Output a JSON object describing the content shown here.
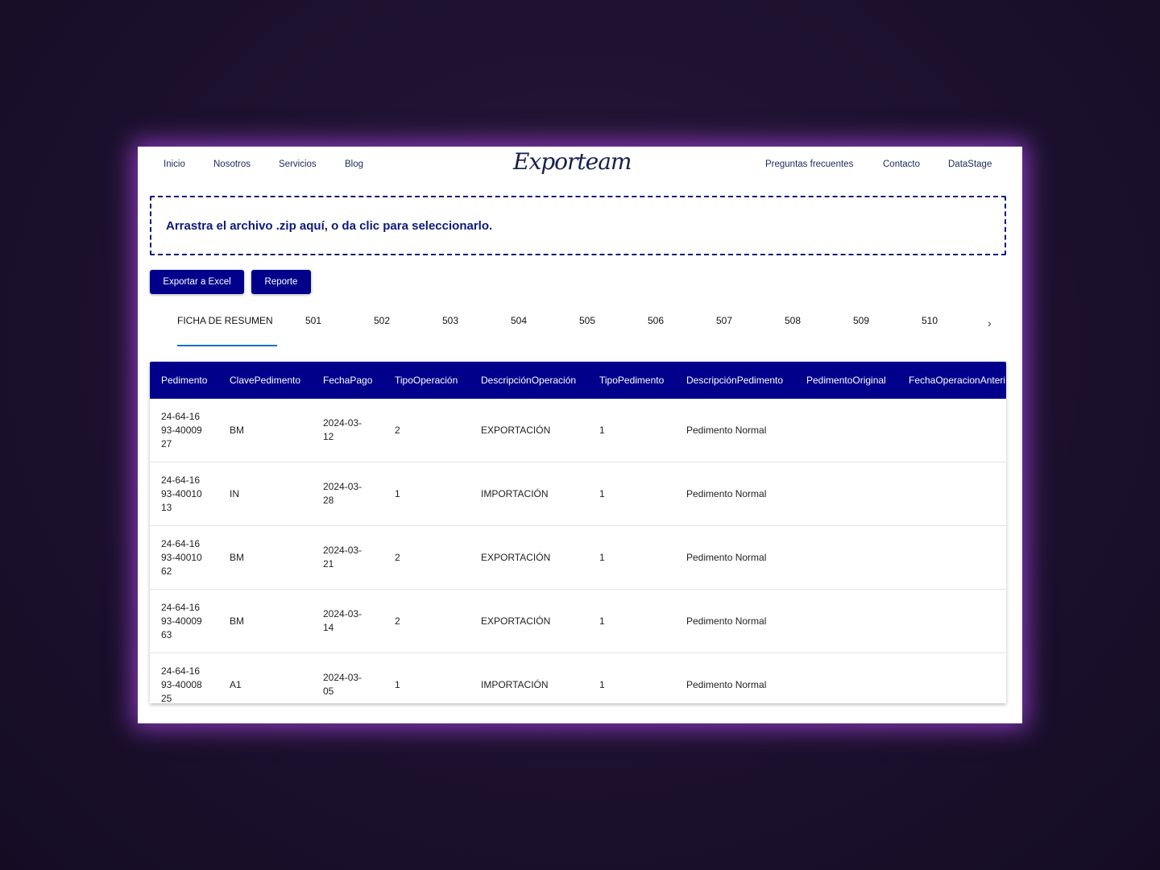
{
  "nav": {
    "left": [
      "Inicio",
      "Nosotros",
      "Servicios",
      "Blog"
    ],
    "logo": "Exporteam",
    "right": [
      "Preguntas frecuentes",
      "Contacto",
      "DataStage"
    ]
  },
  "dropzone": {
    "text": "Arrastra el archivo .zip aquí, o da clic para seleccionarlo."
  },
  "buttons": {
    "export": "Exportar a Excel",
    "report": "Reporte"
  },
  "tabs": [
    "FICHA DE RESUMEN",
    "501",
    "502",
    "503",
    "504",
    "505",
    "506",
    "507",
    "508",
    "509",
    "510"
  ],
  "table": {
    "headers": [
      "Pedimento",
      "ClavePedimento",
      "FechaPago",
      "TipoOperación",
      "DescripciónOperación",
      "TipoPedimento",
      "DescripciónPedimento",
      "PedimentoOriginal",
      "FechaOperacionAnteri"
    ],
    "rows": [
      {
        "pedimento": "24-64-1693-4000927",
        "clave": "BM",
        "fecha": "2024-03-12",
        "tipo_op": "2",
        "desc_op": "EXPORTACIÓN",
        "tipo_ped": "1",
        "desc_ped": "Pedimento Normal"
      },
      {
        "pedimento": "24-64-1693-4001013",
        "clave": "IN",
        "fecha": "2024-03-28",
        "tipo_op": "1",
        "desc_op": "IMPORTACIÓN",
        "tipo_ped": "1",
        "desc_ped": "Pedimento Normal"
      },
      {
        "pedimento": "24-64-1693-4001062",
        "clave": "BM",
        "fecha": "2024-03-21",
        "tipo_op": "2",
        "desc_op": "EXPORTACIÓN",
        "tipo_ped": "1",
        "desc_ped": "Pedimento Normal"
      },
      {
        "pedimento": "24-64-1693-4000963",
        "clave": "BM",
        "fecha": "2024-03-14",
        "tipo_op": "2",
        "desc_op": "EXPORTACIÓN",
        "tipo_ped": "1",
        "desc_ped": "Pedimento Normal"
      },
      {
        "pedimento": "24-64-1693-4000825",
        "clave": "A1",
        "fecha": "2024-03-05",
        "tipo_op": "1",
        "desc_op": "IMPORTACIÓN",
        "tipo_ped": "1",
        "desc_ped": "Pedimento Normal"
      }
    ]
  },
  "colors": {
    "primary": "#00008b",
    "tab_indicator": "#1e6fc7",
    "glow": "#aa46e6"
  }
}
